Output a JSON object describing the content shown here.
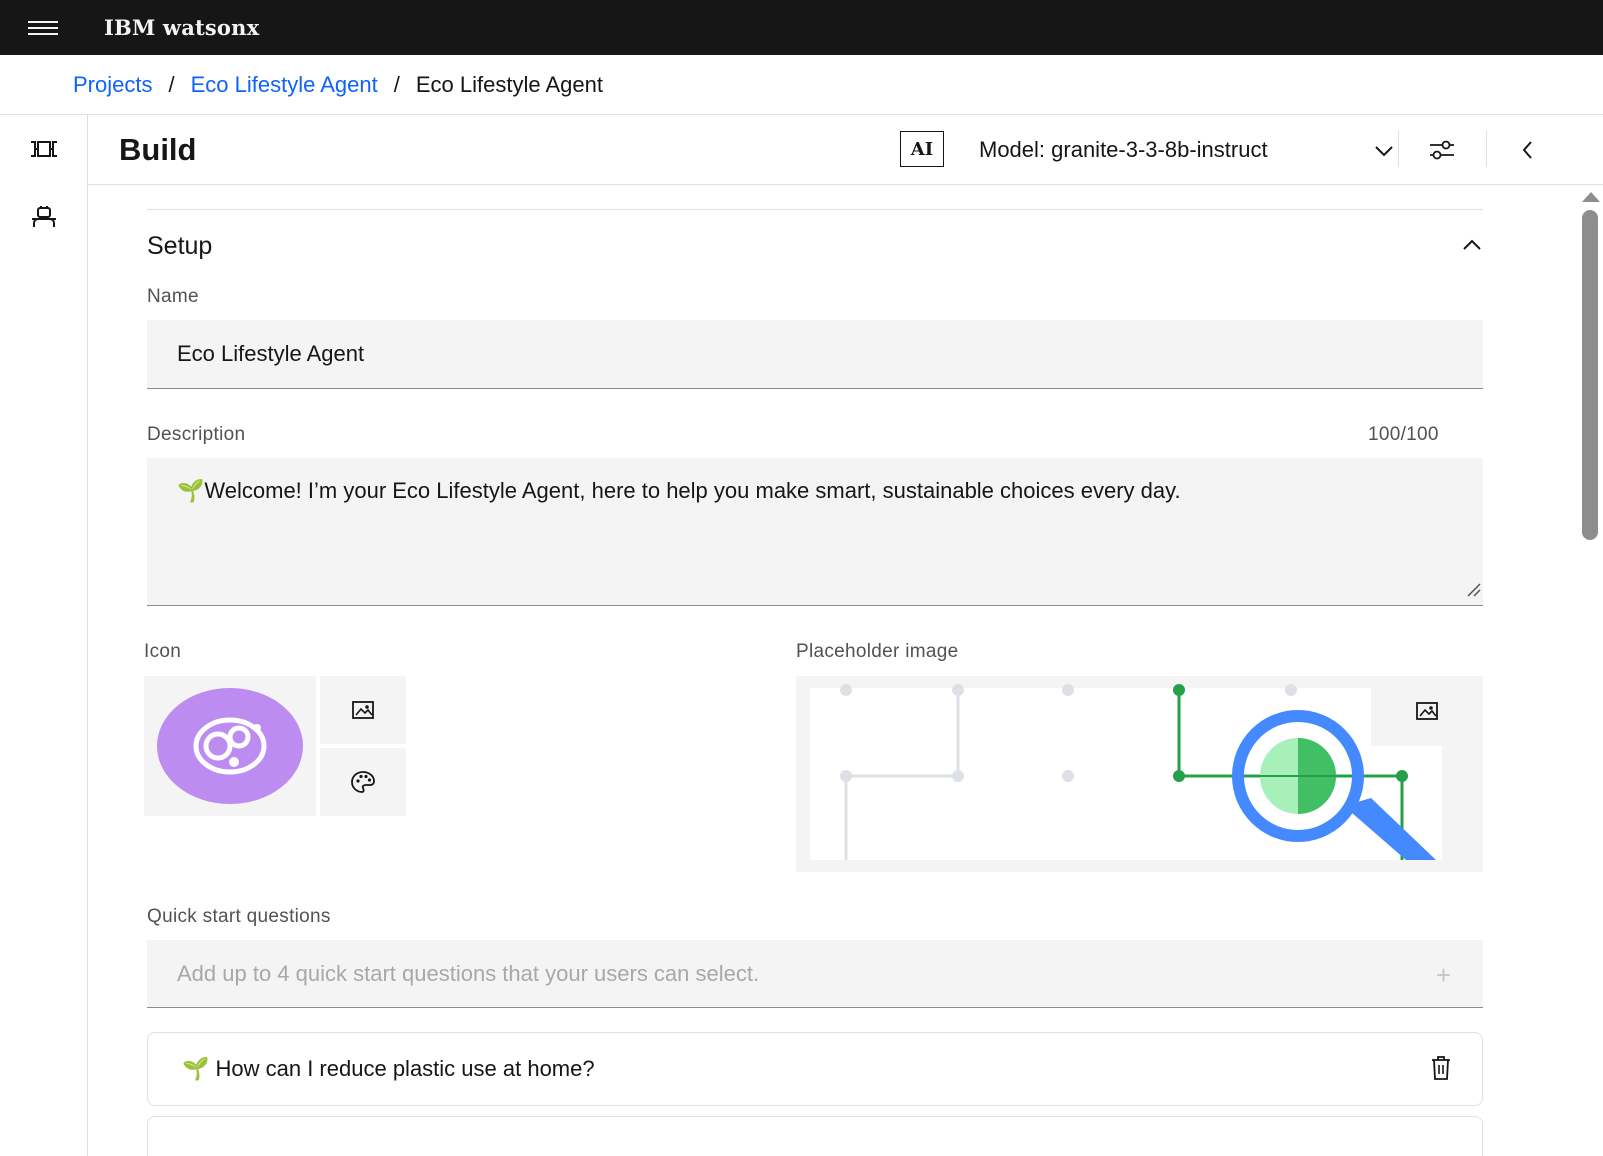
{
  "header": {
    "menu_icon": "hamburger-menu-icon",
    "brand": "IBM watsonx"
  },
  "breadcrumb": {
    "items": [
      {
        "label": "Projects",
        "link": true
      },
      {
        "label": "Eco Lifestyle Agent",
        "link": true
      },
      {
        "label": "Eco Lifestyle Agent",
        "link": false
      }
    ],
    "separator": "/"
  },
  "left_rail": {
    "items": [
      {
        "icon": "pipeline-icon"
      },
      {
        "icon": "agent-icon"
      }
    ]
  },
  "toolbar": {
    "title": "Build",
    "ai_badge": "AI",
    "model_label": "Model: granite-3-3-8b-instruct",
    "settings_icon": "sliders-icon",
    "collapse_icon": "chevron-left-icon"
  },
  "setup": {
    "title": "Setup",
    "name_label": "Name",
    "name_value": "Eco Lifestyle Agent",
    "description_label": "Description",
    "description_count": "100/100",
    "description_value": "🌱Welcome! I’m your Eco Lifestyle Agent, here to help you make smart, sustainable choices every day.",
    "icon_label": "Icon",
    "placeholder_label": "Placeholder image",
    "quick_start_label": "Quick start questions",
    "quick_start_placeholder": "Add up to 4 quick start questions that your users can select.",
    "quick_start_add": "+",
    "questions": [
      {
        "text": "🌱 How can I reduce plastic use at home?"
      }
    ]
  },
  "colors": {
    "header_bg": "#161616",
    "link": "#0f62fe",
    "avatar": "#bc8cf0",
    "field_bg": "#f4f4f4",
    "accent_green": "#24a148",
    "magnifier_blue": "#4589ff"
  }
}
